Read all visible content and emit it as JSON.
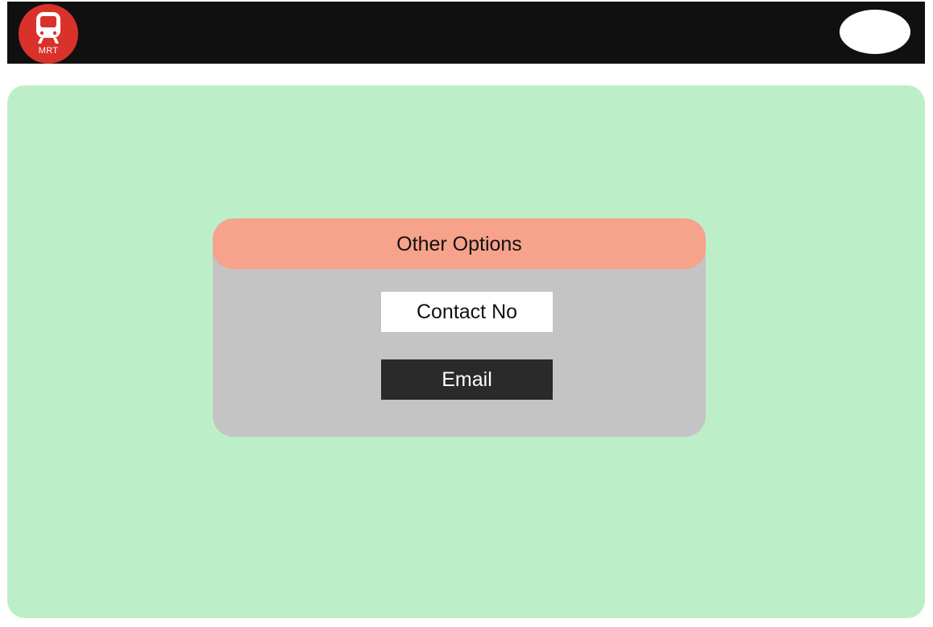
{
  "header": {
    "logo_text": "MRT",
    "logo_icon": "train-icon",
    "profile_icon": "profile-oval"
  },
  "dialog": {
    "title": "Other Options",
    "buttons": {
      "contact_label": "Contact No",
      "email_label": "Email"
    }
  },
  "colors": {
    "header_bg": "#111010",
    "logo_bg": "#d9322b",
    "panel_bg": "#bcefc7",
    "dialog_bg": "#c4c4c4",
    "dialog_header_bg": "#f7a28b",
    "contact_button_bg": "#ffffff",
    "email_button_bg": "#2b2a2a"
  }
}
